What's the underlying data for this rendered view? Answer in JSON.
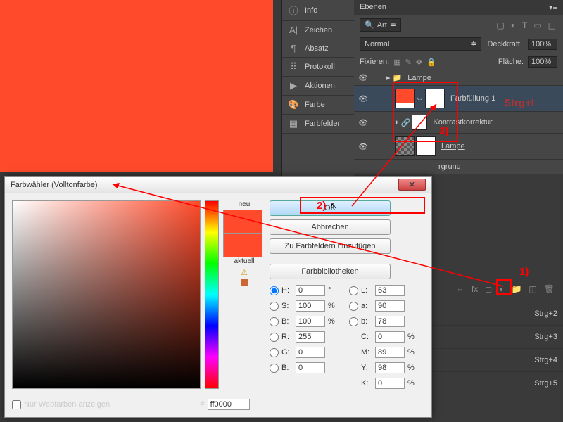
{
  "panels": {
    "info": "Info",
    "zeichen": "Zeichen",
    "absatz": "Absatz",
    "protokoll": "Protokoll",
    "aktionen": "Aktionen",
    "farbe": "Farbe",
    "farbfelder": "Farbfelder"
  },
  "layers_panel": {
    "title": "Ebenen",
    "filter_art": "Art",
    "blend": "Normal",
    "deckkraft_lbl": "Deckkraft:",
    "deckkraft_val": "100%",
    "fixieren": "Fixieren:",
    "flaeche_lbl": "Fläche:",
    "flaeche_val": "100%",
    "items": [
      {
        "name": "Lampe"
      },
      {
        "name": "Farbfüllung 1"
      },
      {
        "name": "Kontrastkorrektur"
      },
      {
        "name": "Lampe"
      },
      {
        "name": "rgrund"
      }
    ]
  },
  "annotations": {
    "step1": "1)",
    "step2": "2)",
    "step3": "3)",
    "shortcut_i": "Strg+I"
  },
  "dialog": {
    "title": "Farbwähler (Volltonfarbe)",
    "neu": "neu",
    "aktuell": "aktuell",
    "ok": "OK",
    "abbrechen": "Abbrechen",
    "zu_farbfeldern": "Zu Farbfeldern hinzufügen",
    "farbbibliotheken": "Farbbibliotheken",
    "h": "H:",
    "h_val": "0",
    "h_unit": "°",
    "s": "S:",
    "s_val": "100",
    "s_unit": "%",
    "b": "B:",
    "b_val": "100",
    "b_unit": "%",
    "r": "R:",
    "r_val": "255",
    "g": "G:",
    "g_val": "0",
    "b2": "B:",
    "b2_val": "0",
    "l": "L:",
    "l_val": "63",
    "a": "a:",
    "a_val": "90",
    "b3": "b:",
    "b3_val": "78",
    "c": "C:",
    "c_val": "0",
    "m": "M:",
    "m_val": "89",
    "y": "Y:",
    "y_val": "98",
    "k": "K:",
    "k_val": "0",
    "webfarben": "Nur Webfarben anzeigen",
    "hex_lbl": "#",
    "hex_val": "ff0000"
  },
  "shortcuts": [
    "Strg+2",
    "Strg+3",
    "Strg+4",
    "Strg+5"
  ]
}
